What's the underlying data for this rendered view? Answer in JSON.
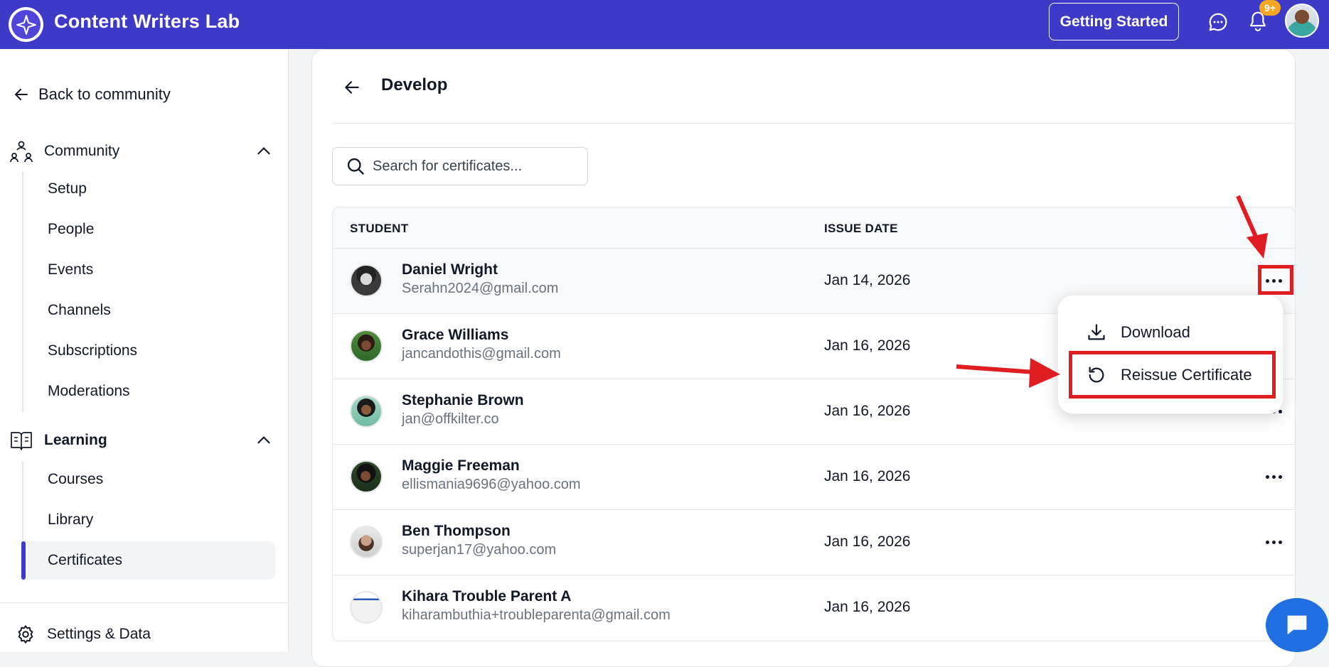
{
  "topbar": {
    "app_title": "Content Writers Lab",
    "getting_started_label": "Getting Started",
    "notification_badge": "9+",
    "accent_color": "#3d3ac8"
  },
  "sidebar": {
    "back_label": "Back to community",
    "community": {
      "label": "Community",
      "items": [
        "Setup",
        "People",
        "Events",
        "Channels",
        "Subscriptions",
        "Moderations"
      ]
    },
    "learning": {
      "label": "Learning",
      "items": [
        "Courses",
        "Library",
        "Certificates"
      ],
      "active": "Certificates"
    },
    "settings_label": "Settings & Data"
  },
  "main": {
    "title": "Develop",
    "search_placeholder": "Search for certificates...",
    "columns": {
      "student": "STUDENT",
      "issue_date": "ISSUE DATE"
    },
    "rows": [
      {
        "name": "Daniel Wright",
        "email": "Serahn2024@gmail.com",
        "date": "Jan 14, 2026"
      },
      {
        "name": "Grace Williams",
        "email": "jancandothis@gmail.com",
        "date": "Jan 16, 2026"
      },
      {
        "name": "Stephanie Brown",
        "email": "jan@offkilter.co",
        "date": "Jan 16, 2026"
      },
      {
        "name": "Maggie Freeman",
        "email": "ellismania9696@yahoo.com",
        "date": "Jan 16, 2026"
      },
      {
        "name": "Ben Thompson",
        "email": "superjan17@yahoo.com",
        "date": "Jan 16, 2026"
      },
      {
        "name": "Kihara Trouble Parent A",
        "email": "kiharambuthia+troubleparenta@gmail.com",
        "date": "Jan 16, 2026"
      }
    ]
  },
  "row_menu": {
    "download_label": "Download",
    "reissue_label": "Reissue Certificate"
  },
  "annotation_color": "#e01e22"
}
